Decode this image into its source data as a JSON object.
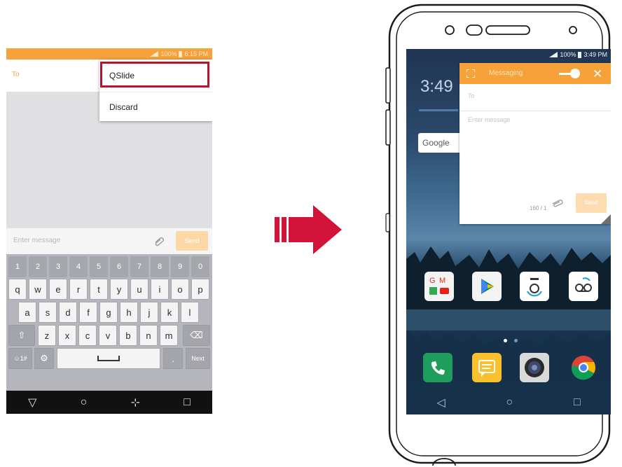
{
  "left": {
    "status": {
      "battery": "100%",
      "time": "6:15 PM"
    },
    "to_label": "To",
    "menu": {
      "items": [
        "QSlide",
        "Discard"
      ]
    },
    "compose": {
      "placeholder": "Enter message",
      "send": "Send"
    },
    "keyboard": {
      "numbers": [
        "1",
        "2",
        "3",
        "4",
        "5",
        "6",
        "7",
        "8",
        "9",
        "0"
      ],
      "row1": [
        "q",
        "w",
        "e",
        "r",
        "t",
        "y",
        "u",
        "i",
        "o",
        "p"
      ],
      "row2": [
        "a",
        "s",
        "d",
        "f",
        "g",
        "h",
        "j",
        "k",
        "l"
      ],
      "row3": [
        "z",
        "x",
        "c",
        "v",
        "b",
        "n",
        "m"
      ],
      "symbols_key": "☺1#",
      "period": ".",
      "next_key": "Next"
    }
  },
  "right": {
    "status": {
      "battery": "100%",
      "time": "3:49 PM"
    },
    "clock": "3:49",
    "google_label": "Google",
    "qslide": {
      "title": "Messaging",
      "to_label": "To",
      "placeholder": "Enter message",
      "counter": "160 / 1",
      "send": "Send"
    },
    "apps": [
      "gmail-folder",
      "play-store",
      "xfinity-app",
      "voicemail-app"
    ],
    "dock": [
      "phone-app",
      "messaging-app",
      "camera-app",
      "chrome-app"
    ]
  },
  "colors": {
    "accent_orange": "#f6a13a",
    "highlight_red": "#b3172f",
    "arrow_red": "#d2143a"
  }
}
